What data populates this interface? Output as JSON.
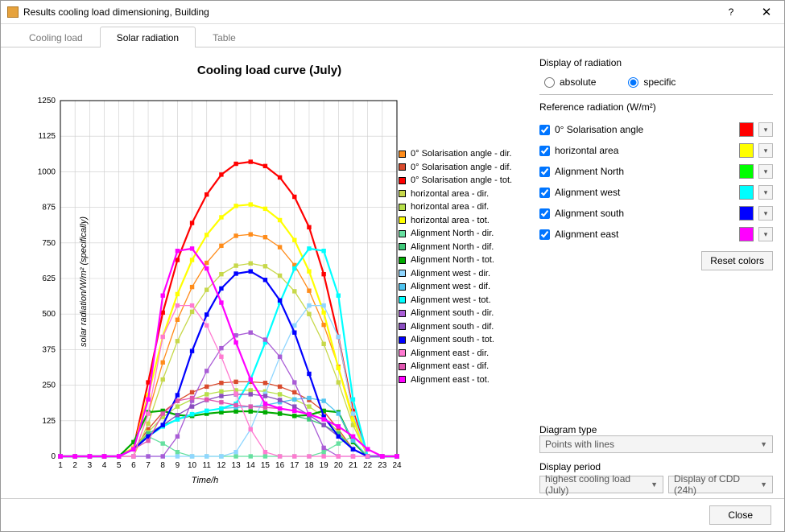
{
  "window": {
    "title": "Results cooling load dimensioning, Building"
  },
  "tabs": {
    "items": [
      {
        "label": "Cooling load",
        "active": false
      },
      {
        "label": "Solar radiation",
        "active": true
      },
      {
        "label": "Table",
        "active": false
      }
    ]
  },
  "side": {
    "display_of_radiation": "Display of radiation",
    "radio_absolute": "absolute",
    "radio_specific": "specific",
    "radio_selected": "specific",
    "reference_title": "Reference radiation (W/m²)",
    "references": [
      {
        "label": "0° Solarisation angle",
        "checked": true,
        "color": "#ff0000"
      },
      {
        "label": "horizontal area",
        "checked": true,
        "color": "#ffff00"
      },
      {
        "label": "Alignment North",
        "checked": true,
        "color": "#00ff00"
      },
      {
        "label": "Alignment west",
        "checked": true,
        "color": "#00ffff"
      },
      {
        "label": "Alignment south",
        "checked": true,
        "color": "#0000ff"
      },
      {
        "label": "Alignment east",
        "checked": true,
        "color": "#ff00ff"
      }
    ],
    "reset_colors": "Reset colors",
    "diagram_type_label": "Diagram type",
    "diagram_type_value": "Points with lines",
    "display_period_label": "Display period",
    "display_period_value1": "highest cooling load (July)",
    "display_period_value2": "Display of CDD (24h)"
  },
  "footer": {
    "close": "Close"
  },
  "chart_data": {
    "type": "line",
    "title": "Cooling load curve (July)",
    "xlabel": "Time/h",
    "ylabel": "solar radiation/W/m² (specifically)",
    "x": [
      1,
      2,
      3,
      4,
      5,
      6,
      7,
      8,
      9,
      10,
      11,
      12,
      13,
      14,
      15,
      16,
      17,
      18,
      19,
      20,
      21,
      22,
      23,
      24
    ],
    "xlim": [
      1,
      24
    ],
    "ylim": [
      0,
      1250
    ],
    "yticks": [
      0,
      125,
      250,
      375,
      500,
      625,
      750,
      875,
      1000,
      1125,
      1250
    ],
    "grid": true,
    "legend_position": "right",
    "series": [
      {
        "name": "0° Solarisation angle - dir.",
        "color": "#ff8c1a",
        "values": [
          0,
          0,
          0,
          0,
          0,
          0,
          150,
          330,
          480,
          595,
          680,
          740,
          775,
          780,
          770,
          735,
          672,
          582,
          462,
          315,
          140,
          0,
          0,
          0
        ]
      },
      {
        "name": "0° Solarisation angle - dif.",
        "color": "#d94b2d",
        "values": [
          0,
          0,
          0,
          0,
          0,
          25,
          95,
          155,
          195,
          225,
          245,
          258,
          262,
          262,
          258,
          245,
          225,
          198,
          158,
          95,
          25,
          0,
          0,
          0
        ]
      },
      {
        "name": "0° Solarisation angle - tot.",
        "color": "#ff0000",
        "values": [
          0,
          0,
          0,
          0,
          0,
          30,
          260,
          505,
          690,
          820,
          920,
          990,
          1028,
          1035,
          1020,
          980,
          912,
          805,
          640,
          420,
          160,
          0,
          0,
          0
        ]
      },
      {
        "name": "horizontal area - dir.",
        "color": "#c7d84a",
        "values": [
          0,
          0,
          0,
          0,
          0,
          0,
          115,
          270,
          405,
          508,
          585,
          640,
          670,
          678,
          668,
          635,
          580,
          500,
          395,
          260,
          110,
          0,
          0,
          0
        ]
      },
      {
        "name": "horizontal area - dif.",
        "color": "#b7e04a",
        "values": [
          0,
          0,
          0,
          0,
          0,
          25,
          85,
          138,
          175,
          200,
          218,
          228,
          232,
          232,
          228,
          218,
          200,
          175,
          138,
          85,
          25,
          0,
          0,
          0
        ]
      },
      {
        "name": "horizontal area - tot.",
        "color": "#ffff00",
        "values": [
          0,
          0,
          0,
          0,
          0,
          30,
          215,
          420,
          570,
          690,
          778,
          840,
          880,
          885,
          870,
          830,
          760,
          650,
          505,
          310,
          130,
          0,
          0,
          0
        ]
      },
      {
        "name": "Alignment North - dir.",
        "color": "#66e0a0",
        "values": [
          0,
          0,
          0,
          0,
          0,
          25,
          70,
          45,
          15,
          0,
          0,
          0,
          0,
          0,
          0,
          0,
          0,
          0,
          15,
          45,
          70,
          25,
          0,
          0
        ]
      },
      {
        "name": "Alignment North - dif.",
        "color": "#3ec97a",
        "values": [
          0,
          0,
          0,
          0,
          0,
          25,
          80,
          110,
          130,
          142,
          150,
          155,
          158,
          158,
          155,
          150,
          142,
          130,
          110,
          80,
          25,
          0,
          0,
          0
        ]
      },
      {
        "name": "Alignment North - tot.",
        "color": "#00aa00",
        "values": [
          0,
          0,
          0,
          0,
          0,
          50,
          155,
          160,
          145,
          142,
          150,
          155,
          158,
          158,
          155,
          150,
          142,
          145,
          160,
          155,
          50,
          0,
          0,
          0
        ]
      },
      {
        "name": "Alignment west - dir.",
        "color": "#8fd6ff",
        "values": [
          0,
          0,
          0,
          0,
          0,
          0,
          0,
          0,
          0,
          0,
          0,
          0,
          15,
          95,
          220,
          350,
          460,
          530,
          530,
          420,
          150,
          0,
          0,
          0
        ]
      },
      {
        "name": "Alignment west - dif.",
        "color": "#4fc4f0",
        "values": [
          0,
          0,
          0,
          0,
          0,
          25,
          70,
          105,
          130,
          148,
          160,
          168,
          172,
          175,
          180,
          190,
          200,
          205,
          195,
          150,
          55,
          0,
          0,
          0
        ]
      },
      {
        "name": "Alignment west - tot.",
        "color": "#00ffff",
        "values": [
          0,
          0,
          0,
          0,
          0,
          25,
          70,
          105,
          130,
          148,
          160,
          168,
          185,
          270,
          400,
          540,
          660,
          730,
          722,
          565,
          200,
          0,
          0,
          0
        ]
      },
      {
        "name": "Alignment south - dir.",
        "color": "#a95cd6",
        "values": [
          0,
          0,
          0,
          0,
          0,
          0,
          0,
          0,
          70,
          195,
          300,
          380,
          425,
          435,
          410,
          350,
          260,
          145,
          30,
          0,
          0,
          0,
          0,
          0
        ]
      },
      {
        "name": "Alignment south - dif.",
        "color": "#8a4dc0",
        "values": [
          0,
          0,
          0,
          0,
          0,
          25,
          70,
          110,
          145,
          175,
          198,
          212,
          218,
          218,
          212,
          198,
          175,
          145,
          110,
          70,
          25,
          0,
          0,
          0
        ]
      },
      {
        "name": "Alignment south - tot.",
        "color": "#0000ff",
        "values": [
          0,
          0,
          0,
          0,
          0,
          25,
          70,
          110,
          215,
          370,
          498,
          590,
          642,
          650,
          620,
          548,
          435,
          290,
          140,
          70,
          25,
          0,
          0,
          0
        ]
      },
      {
        "name": "Alignment east - dir.",
        "color": "#ff7ad1",
        "values": [
          0,
          0,
          0,
          0,
          0,
          0,
          150,
          420,
          530,
          530,
          460,
          350,
          220,
          95,
          15,
          0,
          0,
          0,
          0,
          0,
          0,
          0,
          0,
          0
        ]
      },
      {
        "name": "Alignment east - dif.",
        "color": "#e055b0",
        "values": [
          0,
          0,
          0,
          0,
          0,
          25,
          55,
          150,
          195,
          205,
          200,
          190,
          180,
          175,
          172,
          168,
          160,
          148,
          130,
          105,
          70,
          25,
          0,
          0
        ]
      },
      {
        "name": "Alignment east - tot.",
        "color": "#ff00ff",
        "values": [
          0,
          0,
          0,
          0,
          0,
          25,
          200,
          565,
          722,
          730,
          660,
          540,
          400,
          270,
          185,
          168,
          160,
          148,
          130,
          105,
          70,
          25,
          0,
          0
        ]
      }
    ]
  }
}
